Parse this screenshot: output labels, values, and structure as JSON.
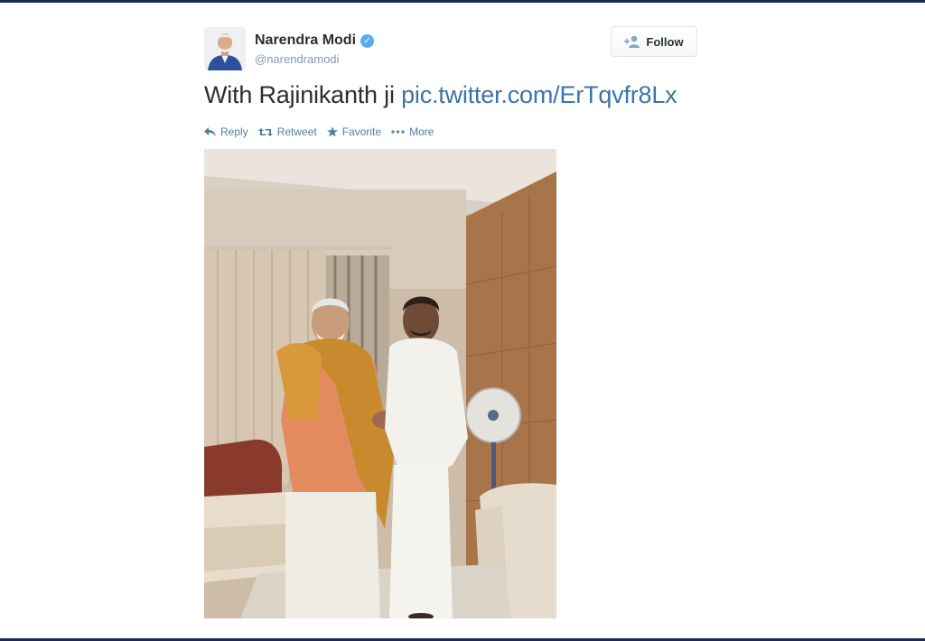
{
  "author": {
    "name": "Narendra Modi",
    "handle": "@narendramodi",
    "verified": true
  },
  "follow_button": {
    "label": "Follow",
    "icon": "add-user-icon"
  },
  "tweet": {
    "text": "With Rajinikanth ji",
    "link": "pic.twitter.com/ErTqvfr8Lx"
  },
  "actions": [
    {
      "label": "Reply",
      "icon": "reply-icon"
    },
    {
      "label": "Retweet",
      "icon": "retweet-icon"
    },
    {
      "label": "Favorite",
      "icon": "star-icon"
    },
    {
      "label": "More",
      "icon": "more-dots-icon"
    }
  ],
  "colors": {
    "link": "#3b74a8",
    "action": "#4f7fa6",
    "verified": "#55acee",
    "frame": "#1b2a52"
  }
}
